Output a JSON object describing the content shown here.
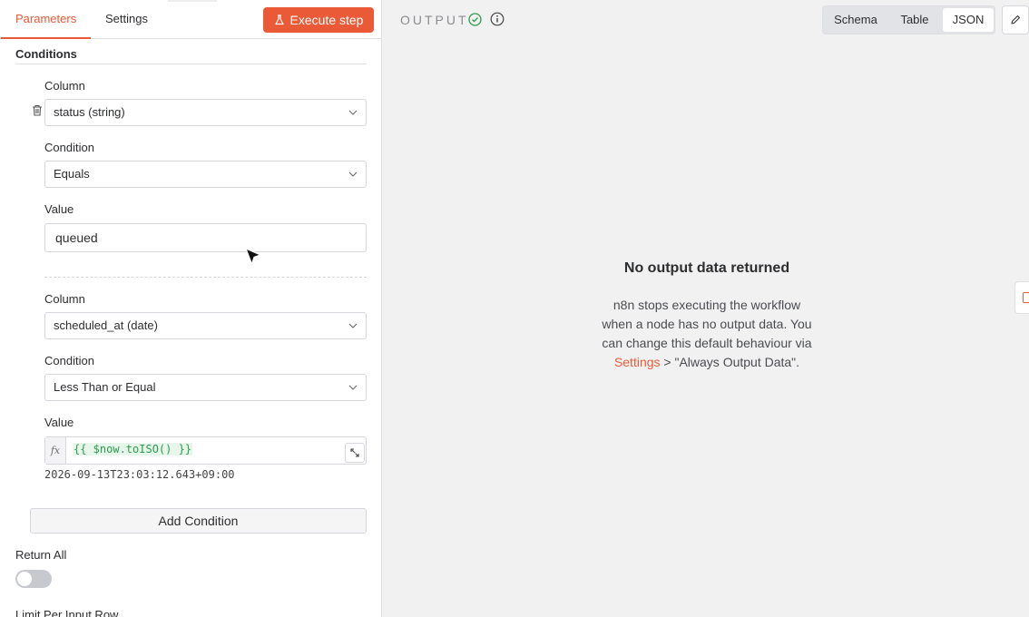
{
  "tabs": {
    "parameters": "Parameters",
    "settings": "Settings"
  },
  "execute_button": "Execute step",
  "conditions": {
    "title": "Conditions",
    "items": [
      {
        "column_label": "Column",
        "column_value": "status (string)",
        "condition_label": "Condition",
        "condition_value": "Equals",
        "value_label": "Value",
        "value": "queued"
      },
      {
        "column_label": "Column",
        "column_value": "scheduled_at (date)",
        "condition_label": "Condition",
        "condition_value": "Less Than or Equal",
        "value_label": "Value",
        "value_expression": "{{ $now.toISO() }}",
        "value_result": "2026-09-13T23:03:12.643+09:00"
      }
    ],
    "add_button": "Add Condition"
  },
  "return_all": {
    "label": "Return All",
    "enabled": false
  },
  "limit_label": "Limit Per Input Row",
  "output": {
    "title": "OUTPUT",
    "views": [
      "Schema",
      "Table",
      "JSON"
    ],
    "active_view": "JSON",
    "empty_title": "No output data returned",
    "empty_text_before": "n8n stops executing the workflow when a node has no output data. You can change this default behaviour via ",
    "empty_link": "Settings",
    "empty_text_after": " > \"Always Output Data\"."
  },
  "colors": {
    "accent": "#ea5a36",
    "success": "#2e9b4f"
  },
  "icons": {
    "fx": "fx"
  }
}
